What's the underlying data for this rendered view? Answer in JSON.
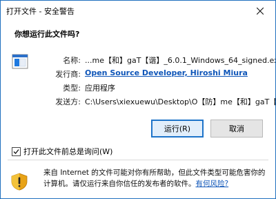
{
  "window": {
    "title": "打开文件 - 安全警告",
    "question": "你想运行此文件吗?"
  },
  "details": {
    "name_label": "名称:",
    "name_value": "...me【和】gaT【谐】_6.0.1_Windows_64_signed.exe",
    "publisher_label": "发行商:",
    "publisher_value": "Open Source Developer, Hiroshi Miura",
    "type_label": "类型:",
    "type_value": "应用程序",
    "from_label": "发送方:",
    "from_value": "C:\\Users\\xiexuewu\\Desktop\\O【防】me【和】gaT【..."
  },
  "buttons": {
    "run": "运行(R)",
    "cancel": "取消"
  },
  "checkbox": {
    "label": "打开此文件前总是询问(W)",
    "checked": true
  },
  "warning": {
    "text": "来自 Internet 的文件可能对你有所帮助，但此文件类型可能危害你的计算机。请仅运行来自你信任的发布者的软件。",
    "link": "有何风险?"
  }
}
